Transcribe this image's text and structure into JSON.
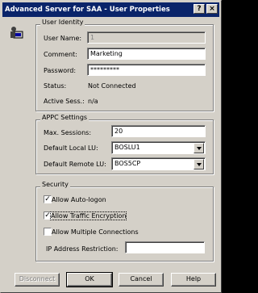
{
  "window": {
    "title": "Advanced Server for SAA - User Properties"
  },
  "identity": {
    "title": "User Identity",
    "user_name_label": "User Name:",
    "user_name_value": "1",
    "comment_label": "Comment:",
    "comment_value": "Marketing",
    "password_label": "Password:",
    "password_value": "*********",
    "status_label": "Status:",
    "status_value": "Not Connected",
    "active_label": "Active Sess.:",
    "active_value": "n/a"
  },
  "appc": {
    "title": "APPC Settings",
    "max_sessions_label": "Max. Sessions:",
    "max_sessions_value": "20",
    "local_lu_label": "Default Local LU:",
    "local_lu_value": "BOSLU1",
    "remote_lu_label": "Default Remote LU:",
    "remote_lu_value": "BOS5CP"
  },
  "security": {
    "title": "Security",
    "auto_logon": {
      "label": "Allow Auto-logon",
      "checked": true
    },
    "traffic_encryption": {
      "label": "Allow Traffic Encryption",
      "checked": true
    },
    "multiple_connections": {
      "label": "Allow Multiple Connections",
      "checked": false
    },
    "ip_restriction_label": "IP Address Restriction:",
    "ip_restriction_value": ""
  },
  "buttons": {
    "disconnect": "Disconnect",
    "ok": "OK",
    "cancel": "Cancel",
    "help": "Help"
  }
}
